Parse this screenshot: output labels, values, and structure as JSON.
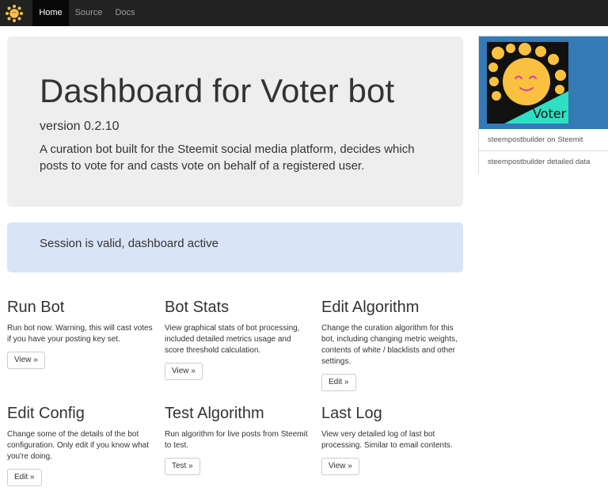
{
  "nav": {
    "items": [
      {
        "label": "Home"
      },
      {
        "label": "Source"
      },
      {
        "label": "Docs"
      }
    ]
  },
  "jumbotron": {
    "title": "Dashboard for Voter bot",
    "version": "version 0.2.10",
    "description": "A curation bot built for the Steemit social media platform, decides which posts to vote for and casts vote on behalf of a registered user."
  },
  "alert": {
    "text": "Session is valid, dashboard active"
  },
  "features": [
    {
      "title": "Run Bot",
      "text": "Run bot now. Warning, this will cast votes if you have your posting key set.",
      "button": "View »"
    },
    {
      "title": "Bot Stats",
      "text": "View graphical stats of bot processing, included detailed metrics usage and score threshold calculation.",
      "button": "View »"
    },
    {
      "title": "Edit Algorithm",
      "text": "Change the curation algorithm for this bot, including changing metric weights, contents of white / blacklists and other settings.",
      "button": "Edit »"
    },
    {
      "title": "Edit Config",
      "text": "Change some of the details of the bot configuration. Only edit if you know what you're doing.",
      "button": "Edit »"
    },
    {
      "title": "Test Algorithm",
      "text": "Run algorithm for live posts from Steemit to test.",
      "button": "Test »"
    },
    {
      "title": "Last Log",
      "text": "View very detailed log of last bot processing. Similar to email contents.",
      "button": "View »"
    }
  ],
  "sidebar": {
    "avatar_text": "Voter",
    "links": [
      {
        "label": "steempostbuilder on Steemit"
      },
      {
        "label": "steempostbuilder detailed data"
      }
    ]
  },
  "colors": {
    "navbar": "#222222",
    "jumbotron": "#eeeeee",
    "alert": "#d9e4f7",
    "sidebar_header": "#337ab7",
    "avatar_sun": "#f9c13f",
    "avatar_teal": "#2de0c4"
  }
}
